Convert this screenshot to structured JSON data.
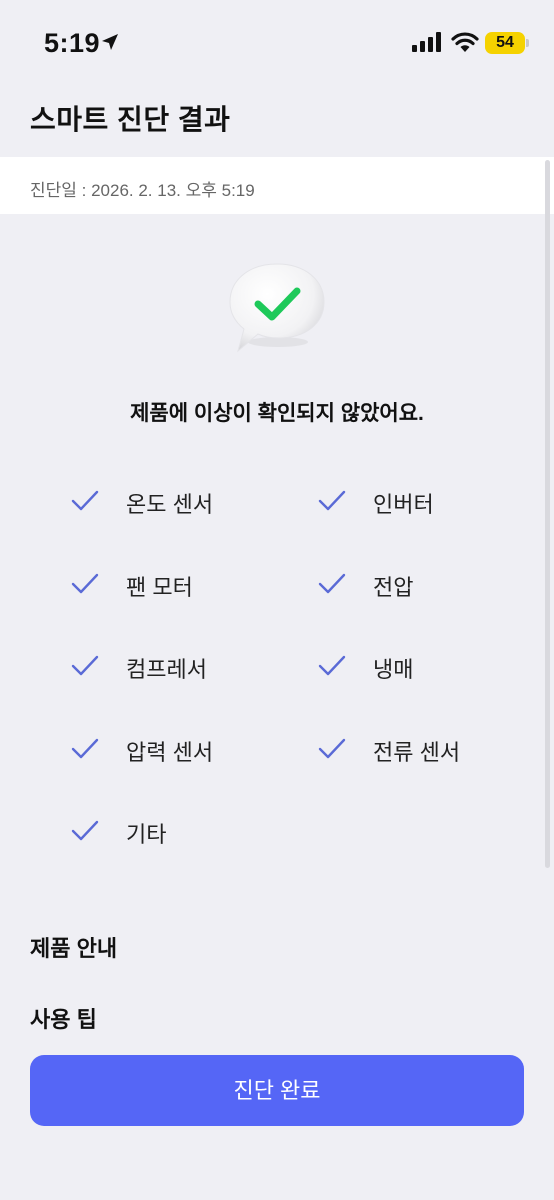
{
  "status_bar": {
    "time": "5:19",
    "battery": "54"
  },
  "header": {
    "title": "스마트 진단 결과"
  },
  "diagnosis": {
    "date_text": "진단일 : 2026. 2. 13. 오후 5:19"
  },
  "result": {
    "message": "제품에 이상이 확인되지 않았어요.",
    "icon": "speech-bubble-check-icon",
    "check_color": "#1ec95a"
  },
  "checks": [
    {
      "label": "온도 센서"
    },
    {
      "label": "인버터"
    },
    {
      "label": "팬 모터"
    },
    {
      "label": "전압"
    },
    {
      "label": "컴프레서"
    },
    {
      "label": "냉매"
    },
    {
      "label": "압력 센서"
    },
    {
      "label": "전류 센서"
    },
    {
      "label": "기타"
    }
  ],
  "sections": {
    "product_info": "제품 안내",
    "usage_tips": "사용 팁"
  },
  "actions": {
    "complete_label": "진단 완료"
  },
  "colors": {
    "accent": "#5566f6",
    "check_mark": "#5a6ad6",
    "background": "#efeff4"
  }
}
